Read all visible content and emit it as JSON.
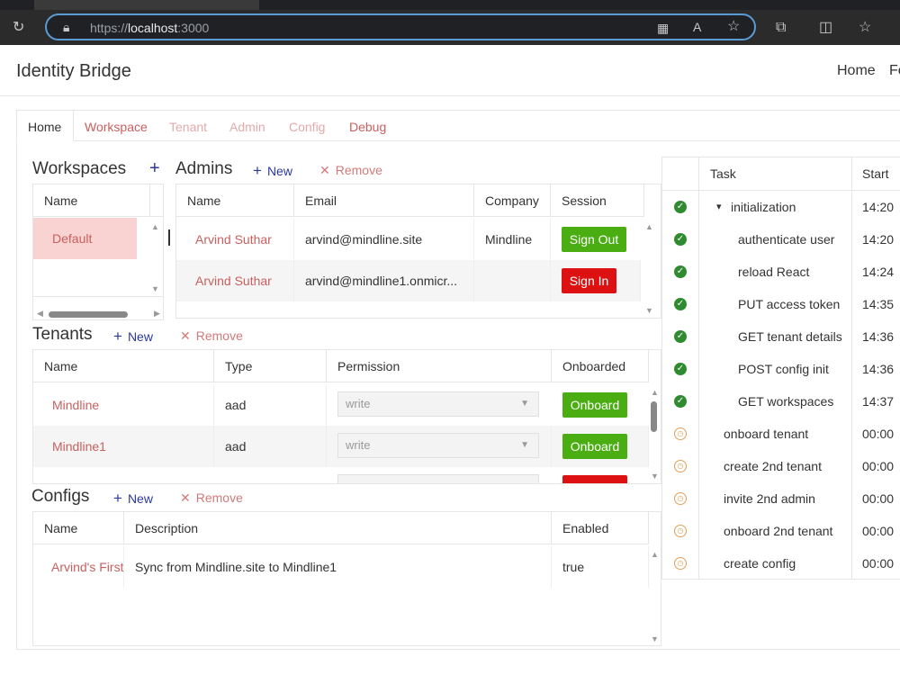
{
  "browser": {
    "url_prefix": "https://",
    "url_host": "localhost",
    "url_port": ":3000"
  },
  "app": {
    "title": "Identity Bridge",
    "nav": [
      "Home",
      "Fe"
    ]
  },
  "tabs": [
    {
      "label": "Home",
      "color": "#333333"
    },
    {
      "label": "Workspace",
      "color": "#c9605f"
    },
    {
      "label": "Tenant",
      "color": "#e3aaaa"
    },
    {
      "label": "Admin",
      "color": "#e3aaaa"
    },
    {
      "label": "Config",
      "color": "#e3aaaa"
    },
    {
      "label": "Debug",
      "color": "#c9605f"
    }
  ],
  "workspaces": {
    "title": "Workspaces",
    "add_icon": "+",
    "columns": [
      "Name"
    ],
    "rows": [
      {
        "name": "Default"
      }
    ]
  },
  "admins": {
    "title": "Admins",
    "new_label": "New",
    "remove_label": "Remove",
    "columns": [
      "Name",
      "Email",
      "Company",
      "Session"
    ],
    "rows": [
      {
        "name": "Arvind Suthar",
        "email": "arvind@mindline.site",
        "company": "Mindline",
        "session": "Sign Out"
      },
      {
        "name": "Arvind Suthar",
        "email": "arvind@mindline1.onmicr...",
        "company": "",
        "session": "Sign In"
      }
    ]
  },
  "tenants": {
    "title": "Tenants",
    "new_label": "New",
    "remove_label": "Remove",
    "columns": [
      "Name",
      "Type",
      "Permission",
      "Onboarded"
    ],
    "rows": [
      {
        "name": "Mindline",
        "type": "aad",
        "permission": "write",
        "onboarded": "Onboard"
      },
      {
        "name": "Mindline1",
        "type": "aad",
        "permission": "write",
        "onboarded": "Onboard"
      }
    ]
  },
  "configs": {
    "title": "Configs",
    "new_label": "New",
    "remove_label": "Remove",
    "columns": [
      "Name",
      "Description",
      "Enabled"
    ],
    "rows": [
      {
        "name": "Arvind's First",
        "description": "Sync from Mindline.site to Mindline1",
        "enabled": "true"
      }
    ]
  },
  "tasks": {
    "columns": [
      "Task",
      "Start"
    ],
    "rows": [
      {
        "name": "initialization",
        "start": "14:20",
        "status": "done",
        "level": 1,
        "expand": "▾"
      },
      {
        "name": "authenticate user",
        "start": "14:20",
        "status": "done",
        "level": 2
      },
      {
        "name": "reload React",
        "start": "14:24",
        "status": "done",
        "level": 2
      },
      {
        "name": "PUT access token",
        "start": "14:35",
        "status": "done",
        "level": 2
      },
      {
        "name": "GET tenant details",
        "start": "14:36",
        "status": "done",
        "level": 2
      },
      {
        "name": "POST config init",
        "start": "14:36",
        "status": "done",
        "level": 2
      },
      {
        "name": "GET workspaces",
        "start": "14:37",
        "status": "done",
        "level": 2
      },
      {
        "name": "onboard tenant",
        "start": "00:00",
        "status": "pending",
        "level": 1
      },
      {
        "name": "create 2nd tenant",
        "start": "00:00",
        "status": "pending",
        "level": 1
      },
      {
        "name": "invite 2nd admin",
        "start": "00:00",
        "status": "pending",
        "level": 1
      },
      {
        "name": "onboard 2nd tenant",
        "start": "00:00",
        "status": "pending",
        "level": 1
      },
      {
        "name": "create config",
        "start": "00:00",
        "status": "pending",
        "level": 1
      }
    ]
  }
}
